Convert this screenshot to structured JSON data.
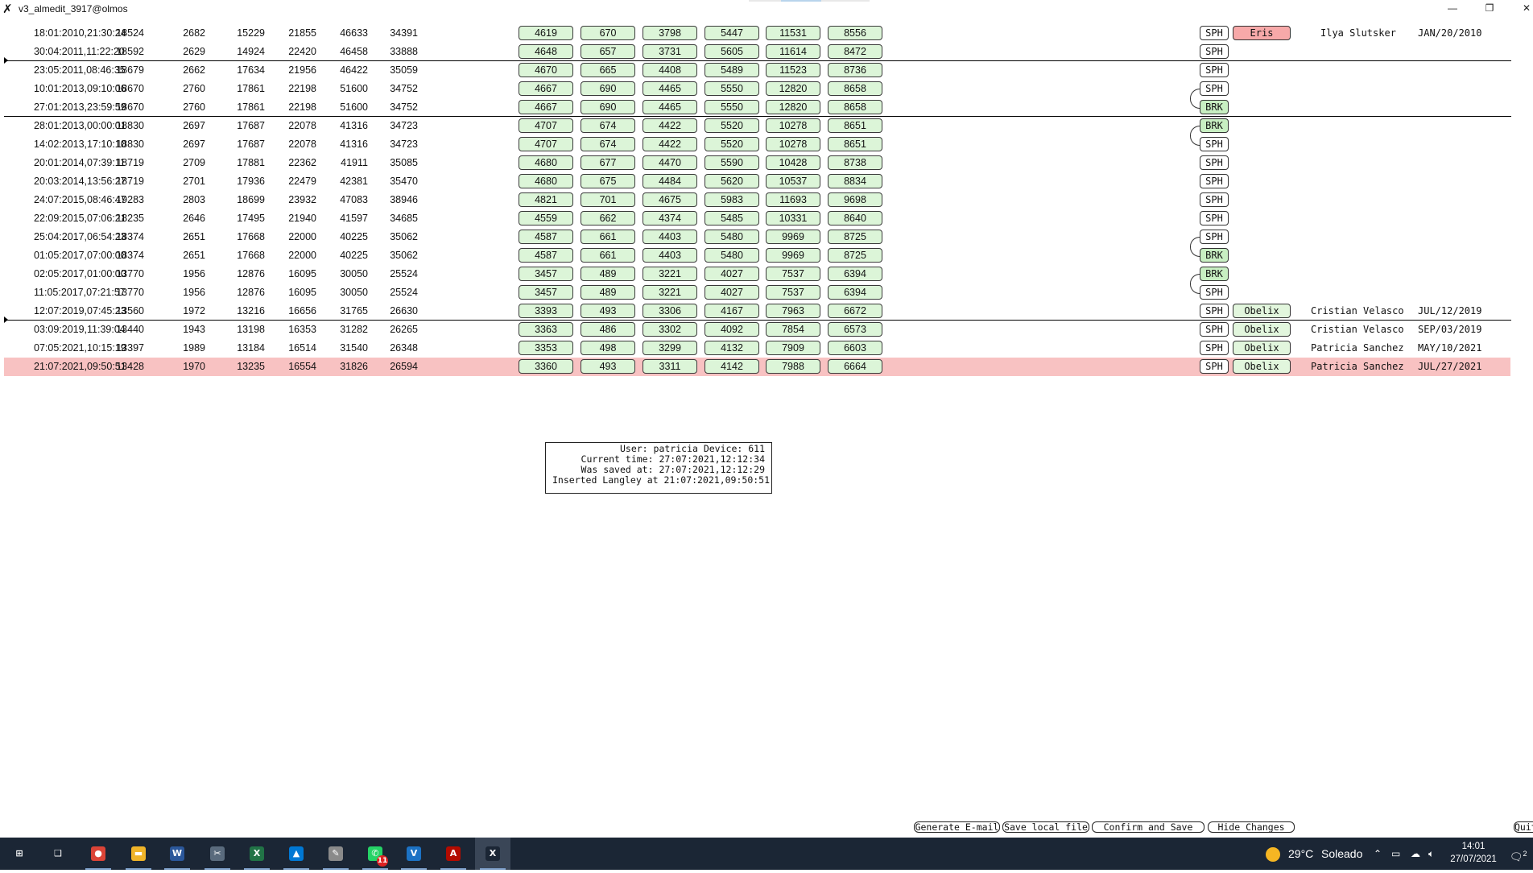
{
  "window": {
    "title": "v3_almedit_3917@olmos",
    "app_icon": "x-app-icon",
    "minimize": "—",
    "restore": "❐",
    "close": "✕"
  },
  "rows": [
    {
      "ts": "18:01:2010,21:30:24",
      "n": [
        "18524",
        "2682",
        "15229",
        "21855",
        "46633",
        "34391"
      ],
      "b": [
        "4619",
        "670",
        "3798",
        "5447",
        "11531",
        "8556"
      ],
      "tag": "SPH",
      "name": "Eris",
      "person": "Ilya Slutsker",
      "date": "JAN/20/2010"
    },
    {
      "ts": "30:04:2011,11:22:20",
      "n": [
        "18592",
        "2629",
        "14924",
        "22420",
        "46458",
        "33888"
      ],
      "b": [
        "4648",
        "657",
        "3731",
        "5605",
        "11614",
        "8472"
      ],
      "tag": "SPH"
    },
    {
      "ts": "23:05:2011,08:46:35",
      "n": [
        "18679",
        "2662",
        "17634",
        "21956",
        "46422",
        "35059"
      ],
      "b": [
        "4670",
        "665",
        "4408",
        "5489",
        "11523",
        "8736"
      ],
      "tag": "SPH"
    },
    {
      "ts": "10:01:2013,09:10:06",
      "n": [
        "18670",
        "2760",
        "17861",
        "22198",
        "51600",
        "34752"
      ],
      "b": [
        "4667",
        "690",
        "4465",
        "5550",
        "12820",
        "8658"
      ],
      "tag": "SPH"
    },
    {
      "ts": "27:01:2013,23:59:59",
      "n": [
        "18670",
        "2760",
        "17861",
        "22198",
        "51600",
        "34752"
      ],
      "b": [
        "4667",
        "690",
        "4465",
        "5550",
        "12820",
        "8658"
      ],
      "tag": "BRK"
    },
    {
      "ts": "28:01:2013,00:00:01",
      "n": [
        "18830",
        "2697",
        "17687",
        "22078",
        "41316",
        "34723"
      ],
      "b": [
        "4707",
        "674",
        "4422",
        "5520",
        "10278",
        "8651"
      ],
      "tag": "BRK"
    },
    {
      "ts": "14:02:2013,17:10:10",
      "n": [
        "18830",
        "2697",
        "17687",
        "22078",
        "41316",
        "34723"
      ],
      "b": [
        "4707",
        "674",
        "4422",
        "5520",
        "10278",
        "8651"
      ],
      "tag": "SPH"
    },
    {
      "ts": "20:01:2014,07:39:11",
      "n": [
        "18719",
        "2709",
        "17881",
        "22362",
        "41911",
        "35085"
      ],
      "b": [
        "4680",
        "677",
        "4470",
        "5590",
        "10428",
        "8738"
      ],
      "tag": "SPH"
    },
    {
      "ts": "20:03:2014,13:56:27",
      "n": [
        "18719",
        "2701",
        "17936",
        "22479",
        "42381",
        "35470"
      ],
      "b": [
        "4680",
        "675",
        "4484",
        "5620",
        "10537",
        "8834"
      ],
      "tag": "SPH"
    },
    {
      "ts": "24:07:2015,08:46:47",
      "n": [
        "19283",
        "2803",
        "18699",
        "23932",
        "47083",
        "38946"
      ],
      "b": [
        "4821",
        "701",
        "4675",
        "5983",
        "11693",
        "9698"
      ],
      "tag": "SPH"
    },
    {
      "ts": "22:09:2015,07:06:21",
      "n": [
        "18235",
        "2646",
        "17495",
        "21940",
        "41597",
        "34685"
      ],
      "b": [
        "4559",
        "662",
        "4374",
        "5485",
        "10331",
        "8640"
      ],
      "tag": "SPH"
    },
    {
      "ts": "25:04:2017,06:54:23",
      "n": [
        "18374",
        "2651",
        "17668",
        "22000",
        "40225",
        "35062"
      ],
      "b": [
        "4587",
        "661",
        "4403",
        "5480",
        "9969",
        "8725"
      ],
      "tag": "SPH"
    },
    {
      "ts": "01:05:2017,07:00:00",
      "n": [
        "18374",
        "2651",
        "17668",
        "22000",
        "40225",
        "35062"
      ],
      "b": [
        "4587",
        "661",
        "4403",
        "5480",
        "9969",
        "8725"
      ],
      "tag": "BRK"
    },
    {
      "ts": "02:05:2017,01:00:00",
      "n": [
        "13770",
        "1956",
        "12876",
        "16095",
        "30050",
        "25524"
      ],
      "b": [
        "3457",
        "489",
        "3221",
        "4027",
        "7537",
        "6394"
      ],
      "tag": "BRK"
    },
    {
      "ts": "11:05:2017,07:21:57",
      "n": [
        "13770",
        "1956",
        "12876",
        "16095",
        "30050",
        "25524"
      ],
      "b": [
        "3457",
        "489",
        "3221",
        "4027",
        "7537",
        "6394"
      ],
      "tag": "SPH"
    },
    {
      "ts": "12:07:2019,07:45:23",
      "n": [
        "13560",
        "1972",
        "13216",
        "16656",
        "31765",
        "26630"
      ],
      "b": [
        "3393",
        "493",
        "3306",
        "4167",
        "7963",
        "6672"
      ],
      "tag": "SPH",
      "name": "Obelix",
      "person": "Cristian Velasco",
      "date": "JUL/12/2019"
    },
    {
      "ts": "03:09:2019,11:39:04",
      "n": [
        "13440",
        "1943",
        "13198",
        "16353",
        "31282",
        "26265"
      ],
      "b": [
        "3363",
        "486",
        "3302",
        "4092",
        "7854",
        "6573"
      ],
      "tag": "SPH",
      "name": "Obelix",
      "person": "Cristian Velasco",
      "date": "SEP/03/2019"
    },
    {
      "ts": "07:05:2021,10:15:19",
      "n": [
        "13397",
        "1989",
        "13184",
        "16514",
        "31540",
        "26348"
      ],
      "b": [
        "3353",
        "498",
        "3299",
        "4132",
        "7909",
        "6603"
      ],
      "tag": "SPH",
      "name": "Obelix",
      "person": "Patricia Sanchez",
      "date": "MAY/10/2021"
    },
    {
      "ts": "21:07:2021,09:50:51",
      "n": [
        "13428",
        "1970",
        "13235",
        "16554",
        "31826",
        "26594"
      ],
      "b": [
        "3360",
        "493",
        "3311",
        "4142",
        "7988",
        "6664"
      ],
      "tag": "SPH",
      "name": "Obelix",
      "person": "Patricia Sanchez",
      "date": "JUL/27/2021",
      "highlight": true
    }
  ],
  "info": {
    "line1": "User: patricia Device: 611",
    "line2": "Current time: 27:07:2021,12:12:34",
    "line3": "Was saved at: 27:07:2021,12:12:29",
    "line4": "Inserted Langley at 21:07:2021,09:50:51"
  },
  "actions": {
    "generate_email": "Generate E-mail",
    "save_local": "Save local file",
    "confirm_save": "Confirm and Save",
    "hide_changes": "Hide Changes",
    "quit": "Quit"
  },
  "taskbar": {
    "apps": [
      {
        "name": "start-icon",
        "glyph": "⊞",
        "color": "#1b2635"
      },
      {
        "name": "task-view-icon",
        "glyph": "❑",
        "color": "#1b2635"
      },
      {
        "name": "chrome-icon",
        "glyph": "●",
        "color": "#db4437"
      },
      {
        "name": "file-explorer-icon",
        "glyph": "▬",
        "color": "#f0b429"
      },
      {
        "name": "word-icon",
        "glyph": "W",
        "color": "#2b579a"
      },
      {
        "name": "screen-snip-icon",
        "glyph": "✂",
        "color": "#5a6b7d"
      },
      {
        "name": "excel-icon",
        "glyph": "X",
        "color": "#217346"
      },
      {
        "name": "photos-icon",
        "glyph": "▲",
        "color": "#0078d4"
      },
      {
        "name": "paint-icon",
        "glyph": "✎",
        "color": "#8a8a8a"
      },
      {
        "name": "whatsapp-icon",
        "glyph": "✆",
        "color": "#25d366",
        "badge": "11"
      },
      {
        "name": "vscode-icon",
        "glyph": "V",
        "color": "#1c72c4"
      },
      {
        "name": "acrobat-icon",
        "glyph": "A",
        "color": "#b30b00"
      },
      {
        "name": "x-app-icon",
        "glyph": "X",
        "color": "#1b2635",
        "active": true
      }
    ],
    "weather_temp": "29°C",
    "weather_text": "Soleado",
    "time": "14:01",
    "date": "27/07/2021",
    "notif_count": "2"
  }
}
